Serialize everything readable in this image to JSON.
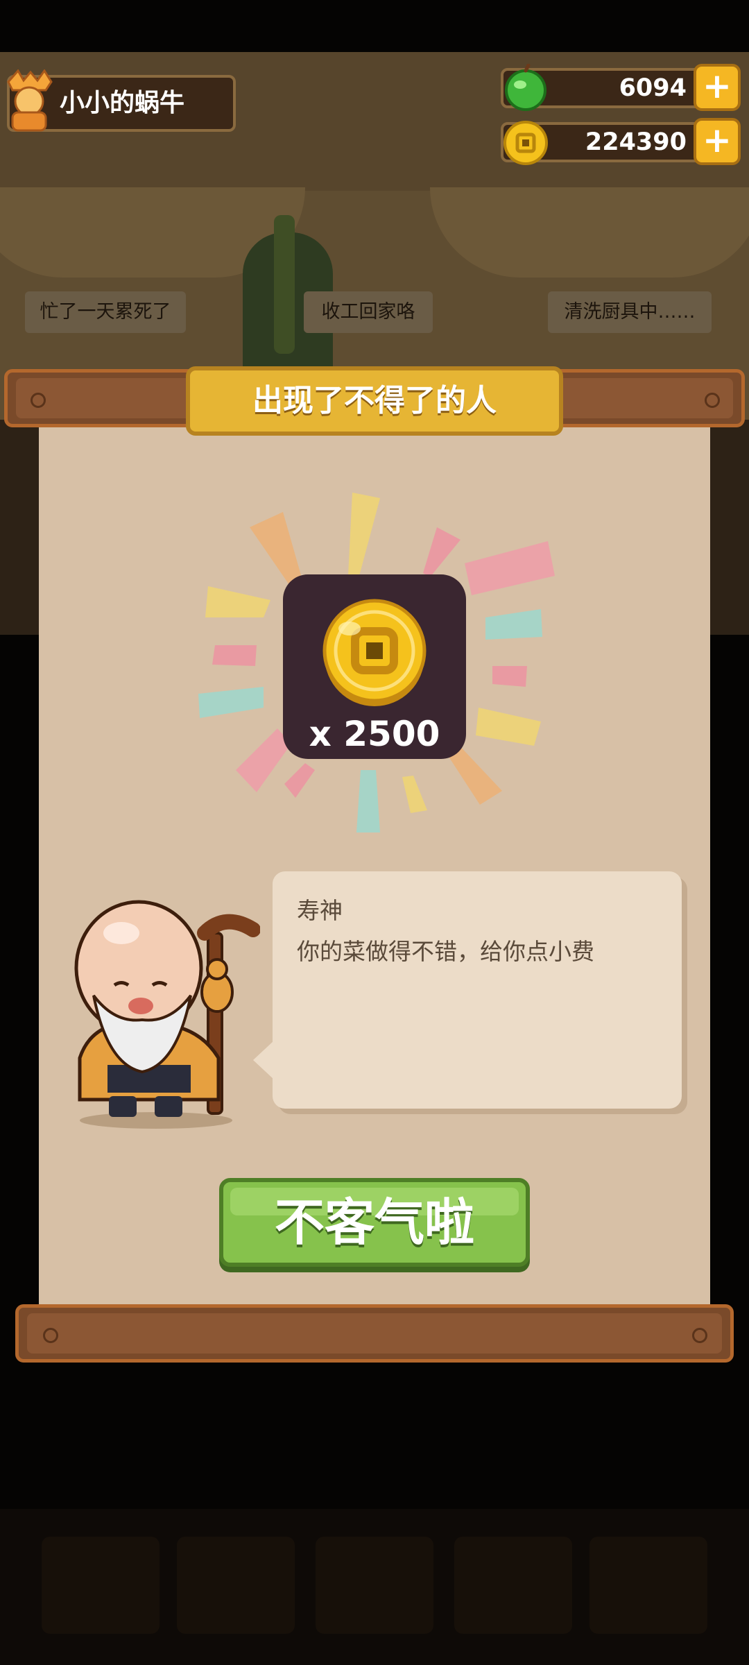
{
  "player": {
    "name": "小小的蜗牛"
  },
  "currencies": [
    {
      "name": "green-gem",
      "value": "6094"
    },
    {
      "name": "coin",
      "value": "224390"
    }
  ],
  "scene_bubbles": [
    "忙了一天累死了",
    "收工回家咯",
    "清洗厨具中……"
  ],
  "dialog": {
    "title": "出现了不得了的人",
    "reward": {
      "icon": "coin-icon",
      "amount_text": "x 2500"
    },
    "speaker": "寿神",
    "message": "你的菜做得不错，给你点小费",
    "confirm_label": "不客气啦"
  },
  "colors": {
    "panel": "#d7c0a6",
    "title_plate": "#e6b534",
    "confirm_green": "#86c24c",
    "coin_gold": "#f5c21c",
    "reward_box": "#3a2630"
  }
}
